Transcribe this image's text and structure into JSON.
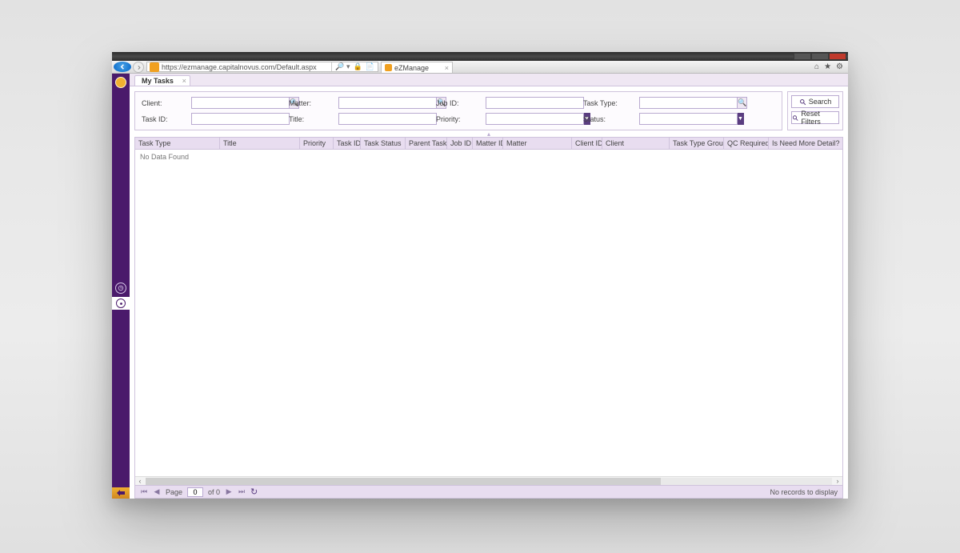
{
  "browser": {
    "url": "https://ezmanage.capitalnovus.com/Default.aspx",
    "search_hint": "",
    "tab_title": "eZManage"
  },
  "app": {
    "tab_title": "My Tasks"
  },
  "filters": {
    "client": {
      "label": "Client:",
      "value": ""
    },
    "matter": {
      "label": "Matter:",
      "value": ""
    },
    "job_id": {
      "label": "Job ID:",
      "value": ""
    },
    "task_type": {
      "label": "Task Type:",
      "value": ""
    },
    "task_id": {
      "label": "Task ID:",
      "value": ""
    },
    "title": {
      "label": "Title:",
      "value": ""
    },
    "priority": {
      "label": "Priority:",
      "value": ""
    },
    "status": {
      "label": "Status:",
      "value": ""
    }
  },
  "actions": {
    "search": "Search",
    "reset": "Reset Filters"
  },
  "grid": {
    "columns": [
      "Task Type",
      "Title",
      "Priority",
      "Task ID",
      "Task Status",
      "Parent Task ID",
      "Job ID",
      "Matter ID",
      "Matter",
      "Client ID",
      "Client",
      "Task Type Group",
      "QC Required",
      "Is Need More Detail?"
    ],
    "empty_text": "No Data Found"
  },
  "pager": {
    "page_label": "Page",
    "page_value": "0",
    "of_label": "of 0",
    "status": "No records to display"
  }
}
